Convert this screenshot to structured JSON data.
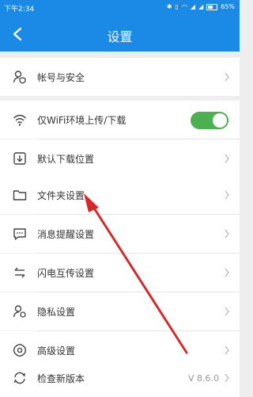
{
  "status_bar": {
    "time": "下午2:34",
    "battery": "65%",
    "icons": [
      "bluetooth-icon",
      "vibrate-icon",
      "wifi-icon",
      "signal-icon",
      "battery-icon"
    ]
  },
  "app_bar": {
    "title": "设置",
    "back_icon": "back-arrow-icon"
  },
  "colors": {
    "accent": "#1a8ae6",
    "toggle_on": "#4caf50",
    "arrow": "#d42a2a"
  },
  "settings": {
    "account_security": "帐号与安全",
    "wifi_only_transfer": "仅WiFi环境上传/下载",
    "wifi_only_enabled": true,
    "default_download_location": "默认下载位置",
    "folder_settings": "文件夹设置",
    "message_notifications": "消息提醒设置",
    "flash_transfer": "闪电互传设置",
    "privacy": "隐私设置",
    "advanced": "高级设置",
    "check_update": "检查新版本",
    "version": "V 8.6.0"
  }
}
